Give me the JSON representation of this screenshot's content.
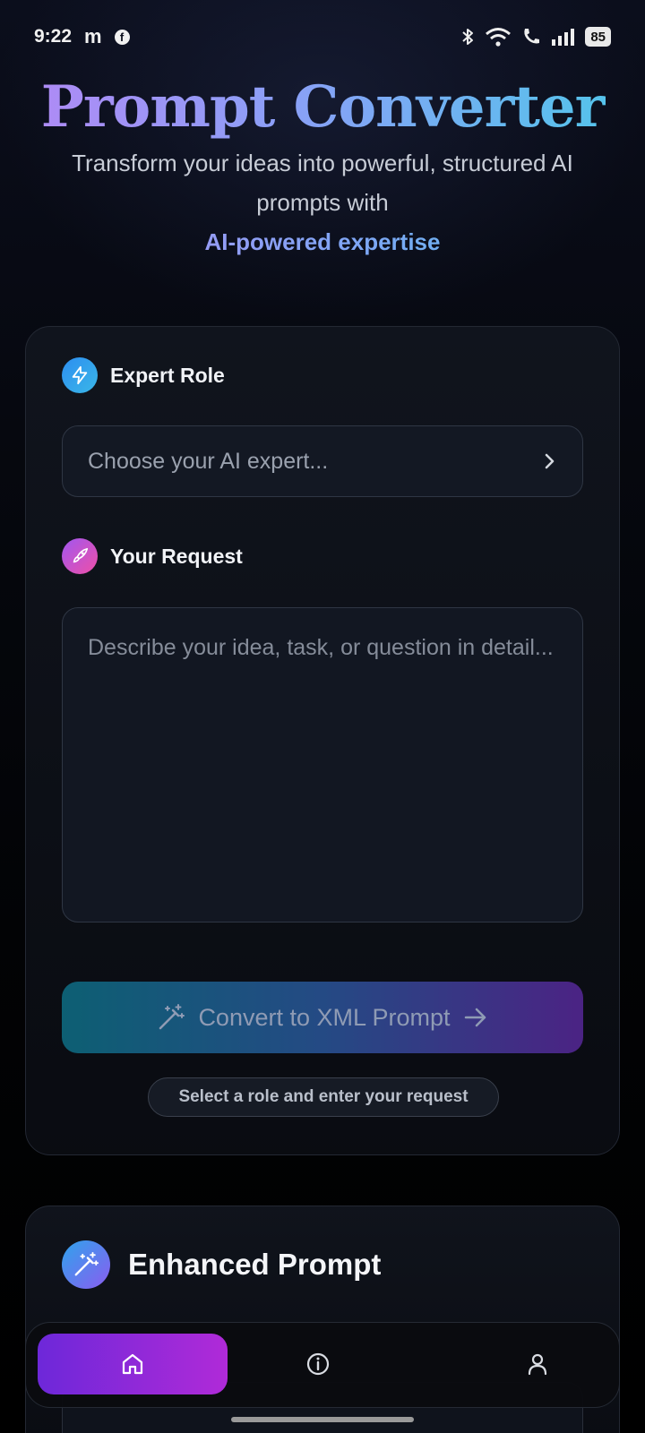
{
  "status_bar": {
    "time": "9:22",
    "app_icon_m": "m",
    "battery": "85",
    "icons": [
      "bluetooth-icon",
      "wifi-icon",
      "call-icon",
      "signal-icon",
      "battery-icon"
    ]
  },
  "header": {
    "title": "Prompt Converter",
    "subtitle": "Transform your ideas into powerful, structured AI prompts with",
    "highlight": "AI-powered expertise"
  },
  "form": {
    "role_label": "Expert Role",
    "role_placeholder": "Choose your AI expert...",
    "request_label": "Your Request",
    "request_placeholder": "Describe your idea, task, or question in detail...",
    "convert_label": "Convert to XML Prompt",
    "hint": "Select a role and enter your request"
  },
  "enhanced": {
    "title": "Enhanced Prompt"
  },
  "nav": {
    "items": [
      {
        "name": "home",
        "icon": "home-icon",
        "active": true
      },
      {
        "name": "info",
        "icon": "info-icon",
        "active": false
      },
      {
        "name": "profile",
        "icon": "user-icon",
        "active": false
      }
    ]
  },
  "colors": {
    "background": "#05070c",
    "title_gradient_start": "#b388f5",
    "title_gradient_end": "#4fc7ea",
    "nav_active_start": "#6d28d9",
    "nav_active_end": "#b02ad8",
    "button_gradient_start": "#0d5f73",
    "button_gradient_end": "#4b2384"
  }
}
